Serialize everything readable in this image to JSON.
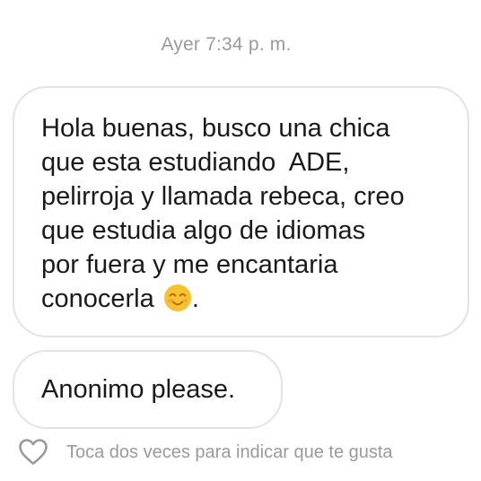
{
  "timestamp": "Ayer 7:34 p. m.",
  "messages": [
    {
      "lines": [
        "Hola buenas, busco una chica",
        "que esta estudiando  ADE,",
        "pelirroja y llamada rebeca, creo",
        "que estudia algo de idiomas",
        "por fuera y me encantaria",
        "conocerla"
      ],
      "trailing_emoji": "smiling-face-emoji",
      "trailing_text": "."
    },
    {
      "text": "Anonimo please."
    }
  ],
  "like_hint": {
    "icon": "heart-outline-icon",
    "text": "Toca dos veces para indicar que te gusta"
  },
  "colors": {
    "background": "#ffffff",
    "bubble_border": "#e3e3e3",
    "message_text": "#1a1a1a",
    "secondary_text": "#9a9a9a",
    "emoji_fill": "#f7c12f"
  }
}
